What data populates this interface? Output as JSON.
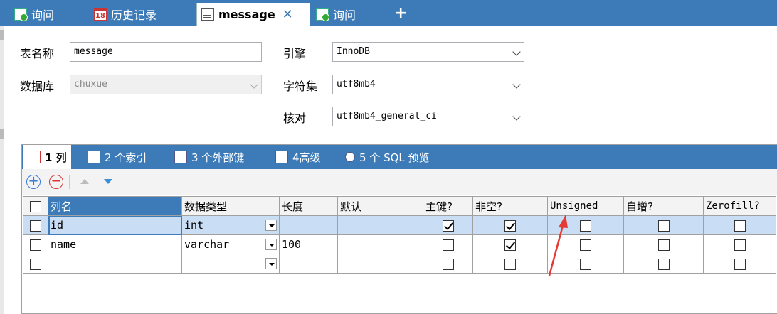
{
  "tabs": [
    {
      "label": "询问",
      "icon": "query-icon"
    },
    {
      "label": "历史记录",
      "icon": "calendar-icon",
      "icon_text": "18"
    },
    {
      "label": "message",
      "icon": "table-design-icon",
      "close": "✕"
    },
    {
      "label": "询问",
      "icon": "query-icon"
    }
  ],
  "new_tab": "+",
  "form": {
    "table_name_label": "表名称",
    "table_name_value": "message",
    "database_label": "数据库",
    "database_value": "chuxue",
    "engine_label": "引擎",
    "engine_value": "InnoDB",
    "charset_label": "字符集",
    "charset_value": "utf8mb4",
    "collation_label": "核对",
    "collation_value": "utf8mb4_general_ci"
  },
  "subtabs": [
    "1 列",
    "2 个索引",
    "3 个外部键",
    "4高级",
    "5 个 SQL 预览"
  ],
  "toolbar": {
    "add": "+",
    "remove": "−"
  },
  "columns": {
    "headers": [
      "列名",
      "数据类型",
      "长度",
      "默认",
      "主键?",
      "非空?",
      "Unsigned",
      "自增?",
      "Zerofill?"
    ],
    "rows": [
      {
        "name": "id",
        "type": "int",
        "length": "",
        "default": "",
        "pk": true,
        "notnull": true,
        "unsigned": false,
        "autoinc": false,
        "zerofill": false
      },
      {
        "name": "name",
        "type": "varchar",
        "length": "100",
        "default": "",
        "pk": false,
        "notnull": true,
        "unsigned": false,
        "autoinc": false,
        "zerofill": false
      },
      {
        "name": "",
        "type": "",
        "length": "",
        "default": "",
        "pk": false,
        "notnull": false,
        "unsigned": false,
        "autoinc": false,
        "zerofill": false
      }
    ]
  },
  "colors": {
    "accent": "#3c7bb8",
    "annotation": "#e53935",
    "selected_row": "#c9def5"
  }
}
